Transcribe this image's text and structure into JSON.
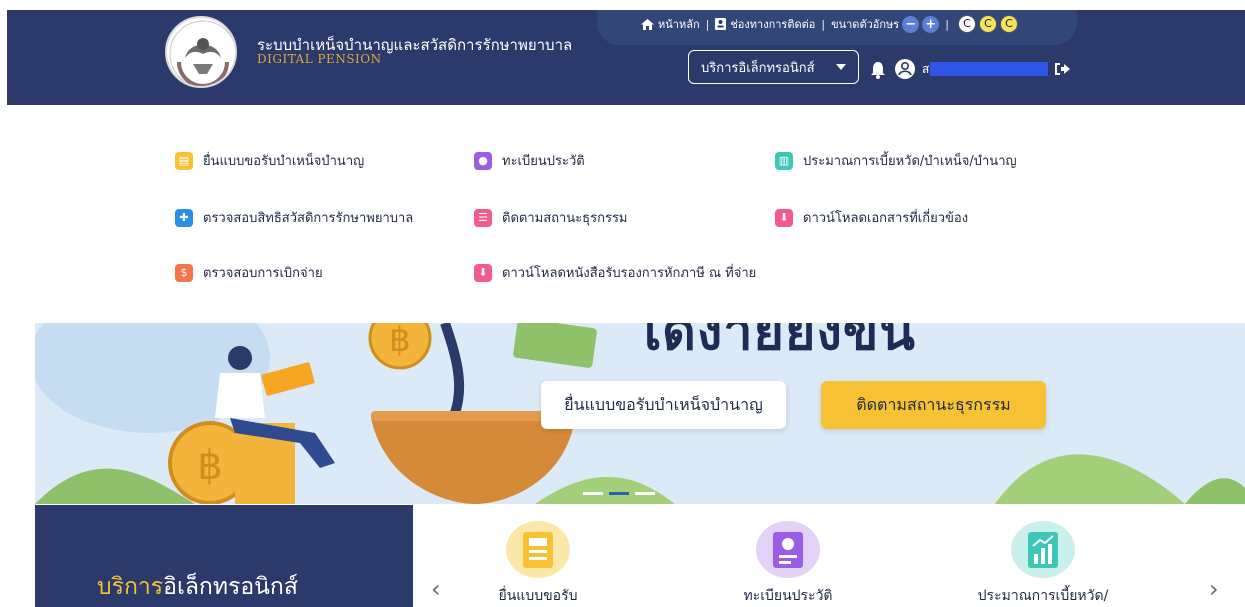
{
  "header": {
    "title": "ระบบบำเหน็จบำนาญและสวัสดิการรักษาพยาบาล",
    "subtitle": "DIGITAL PENSION",
    "topbar": {
      "home_label": "หน้าหลัก",
      "contact_label": "ช่องทางการติดต่อ",
      "font_size_label": "ขนาดตัวอักษร",
      "font_decrease": "−",
      "font_increase": "+",
      "contrast_label": "C"
    },
    "eservice_select": "บริการอิเล็กทรอนิกส์",
    "user_name_lead": "ส"
  },
  "menu": {
    "items": [
      {
        "label": "ยื่นแบบขอรับบำเหน็จบำนาญ",
        "icon": "form-icon",
        "color": "#f6c234"
      },
      {
        "label": "ทะเบียนประวัติ",
        "icon": "profile-icon",
        "color": "#9b5de5"
      },
      {
        "label": "ประมาณการเบี้ยหวัด/บำเหน็จ/บำนาญ",
        "icon": "chart-icon",
        "color": "#3ec7b7"
      },
      {
        "label": "ตรวจสอบสิทธิสวัสดิการรักษาพยาบาล",
        "icon": "health-icon",
        "color": "#2d8ee5"
      },
      {
        "label": "ติดตามสถานะธุรกรรม",
        "icon": "list-icon",
        "color": "#f25c8a"
      },
      {
        "label": "ดาวน์โหลดเอกสารที่เกี่ยวข้อง",
        "icon": "download-icon",
        "color": "#f25c8a"
      },
      {
        "label": "ตรวจสอบการเบิกจ่าย",
        "icon": "payment-icon",
        "color": "#f5754a"
      },
      {
        "label": "ดาวน์โหลดหนังสือรับรองการหักภาษี ณ ที่จ่าย",
        "icon": "download-icon",
        "color": "#f25c8a"
      }
    ]
  },
  "banner": {
    "heading": "ได้ง่ายยิ่งขึ้น",
    "cta_primary": "ยื่นแบบขอรับบำเหน็จบำนาญ",
    "cta_secondary": "ติดตามสถานะธุรกรรม",
    "coin_symbol": "฿"
  },
  "eservice": {
    "title_highlight": "บริการ",
    "title_rest": "อิเล็กทรอนิกส์",
    "cards": [
      {
        "label": "ยื่นแบบขอรับ",
        "icon": "form-icon",
        "color": "#f6c234"
      },
      {
        "label": "ทะเบียนประวัติ",
        "icon": "profile-icon",
        "color": "#9b5de5"
      },
      {
        "label": "ประมาณการเบี้ยหวัด/",
        "icon": "chart-icon",
        "color": "#3ec7b7"
      }
    ],
    "prev": "‹",
    "next": "›"
  }
}
